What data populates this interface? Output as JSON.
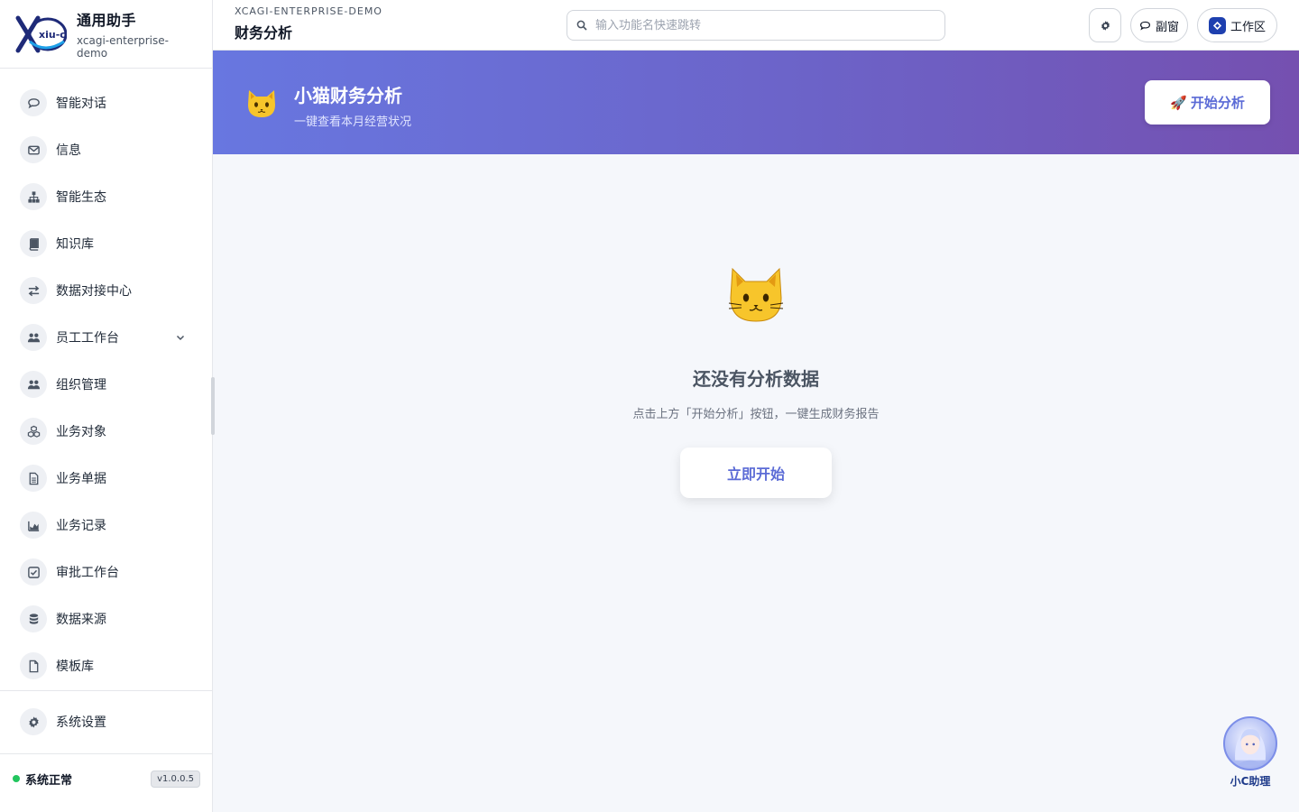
{
  "brand": {
    "logo_text": "xiu-ci",
    "title": "通用助手",
    "subtitle": "xcagi-enterprise-demo"
  },
  "sidebar": {
    "items": [
      {
        "label": "智能对话",
        "icon": "chat-icon"
      },
      {
        "label": "信息",
        "icon": "mail-icon"
      },
      {
        "label": "智能生态",
        "icon": "sitemap-icon"
      },
      {
        "label": "知识库",
        "icon": "book-icon"
      },
      {
        "label": "数据对接中心",
        "icon": "exchange-icon"
      },
      {
        "label": "员工工作台",
        "icon": "users-icon",
        "expandable": true
      },
      {
        "label": "组织管理",
        "icon": "users-icon"
      },
      {
        "label": "业务对象",
        "icon": "cubes-icon"
      },
      {
        "label": "业务单据",
        "icon": "document-icon"
      },
      {
        "label": "业务记录",
        "icon": "chart-icon"
      },
      {
        "label": "审批工作台",
        "icon": "check-square-icon"
      },
      {
        "label": "数据来源",
        "icon": "database-icon"
      },
      {
        "label": "模板库",
        "icon": "file-icon"
      }
    ],
    "settings_label": "系统设置",
    "status_text": "系统正常",
    "version": "v1.0.0.5"
  },
  "header": {
    "breadcrumb_top": "XCAGI-ENTERPRISE-DEMO",
    "page_title": "财务分析",
    "search_placeholder": "输入功能名快速跳转",
    "sub_window_label": "副窗",
    "workspace_label": "工作区"
  },
  "banner": {
    "title": "小猫财务分析",
    "subtitle": "一键查看本月经营状况",
    "button_label": "开始分析"
  },
  "empty_state": {
    "title": "还没有分析数据",
    "subtitle": "点击上方「开始分析」按钮，一键生成财务报告",
    "button_label": "立即开始"
  },
  "assistant": {
    "label": "小C助理"
  },
  "colors": {
    "accent": "#5b6bd6",
    "banner_start": "#6877e0",
    "banner_end": "#7550b0",
    "status_ok": "#22c55e"
  }
}
